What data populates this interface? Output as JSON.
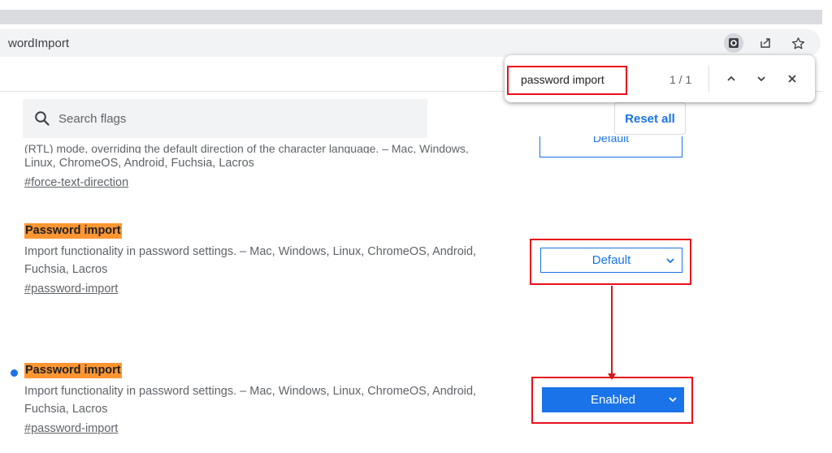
{
  "omnibox": {
    "url": "wordImport"
  },
  "find_bar": {
    "query": "password import",
    "count": "1 / 1"
  },
  "search": {
    "placeholder": "Search flags"
  },
  "reset_label": "Reset all",
  "partial_flag": {
    "description_tail": "(RTL) mode, overriding the default direction of the character language. – Mac, Windows,",
    "platforms_line": "Linux, ChromeOS, Android, Fuchsia, Lacros",
    "link": "#force-text-direction",
    "select_value": "Default"
  },
  "flags": [
    {
      "title": "Password import",
      "description_line1": "Import functionality in password settings. – Mac, Windows, Linux, ChromeOS, Android,",
      "description_line2": "Fuchsia, Lacros",
      "link": "#password-import",
      "select_value": "Default"
    },
    {
      "title": "Password import",
      "description_line1": "Import functionality in password settings. – Mac, Windows, Linux, ChromeOS, Android,",
      "description_line2": "Fuchsia, Lacros",
      "link": "#password-import",
      "select_value": "Enabled"
    }
  ],
  "colors": {
    "accent": "#1a73e8",
    "highlight": "#ff9632",
    "annotation": "#e8101c"
  },
  "icons": [
    "search-icon",
    "zoom-lens-icon",
    "share-icon",
    "star-icon",
    "chevron-up-icon",
    "chevron-down-icon",
    "close-icon"
  ]
}
